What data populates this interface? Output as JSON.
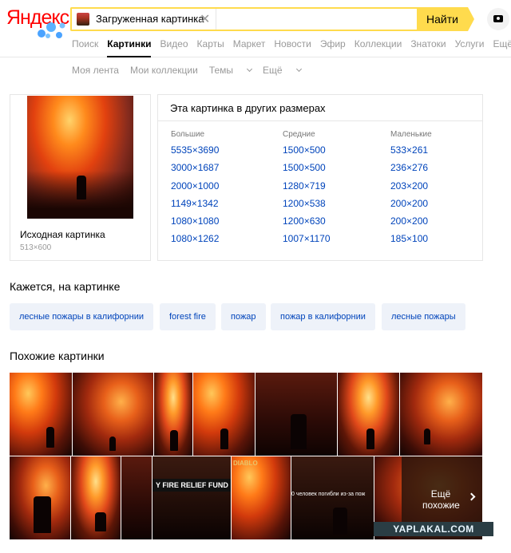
{
  "header": {
    "logo": "Яндекс",
    "search_value": "Загруженная картинка",
    "find_label": "Найти"
  },
  "nav": [
    "Поиск",
    "Картинки",
    "Видео",
    "Карты",
    "Маркет",
    "Новости",
    "Эфир",
    "Коллекции",
    "Знатоки",
    "Услуги",
    "Ещё"
  ],
  "subnav": [
    "Моя лента",
    "Мои коллекции",
    "Темы",
    "Ещё"
  ],
  "original": {
    "label": "Исходная картинка",
    "size": "513×600"
  },
  "sizes": {
    "title": "Эта картинка в других размерах",
    "large_head": "Большие",
    "medium_head": "Средние",
    "small_head": "Маленькие",
    "large": [
      "5535×3690",
      "3000×1687",
      "2000×1000",
      "1149×1342",
      "1080×1080",
      "1080×1262"
    ],
    "medium": [
      "1500×500",
      "1500×500",
      "1280×719",
      "1200×538",
      "1200×630",
      "1007×1170"
    ],
    "small": [
      "533×261",
      "236×276",
      "203×200",
      "200×200",
      "200×200",
      "185×100"
    ]
  },
  "tags_title": "Кажется, на картинке",
  "tags": [
    "лесные пожары в калифорнии",
    "forest fire",
    "пожар",
    "пожар в калифорнии",
    "лесные пожары"
  ],
  "similar_title": "Похожие картинки",
  "similar": {
    "banner_text": "Y FIRE RELIEF FUND",
    "caption_text": "0 человек погибли из-за пож",
    "game_logo": "DIABLO",
    "more_label": "Ещё похожие"
  },
  "watermark": "YAPLAKAL.COM",
  "colors": {
    "accent": "#ffdb4d",
    "link": "#0044bb",
    "logo": "#ff0000"
  }
}
